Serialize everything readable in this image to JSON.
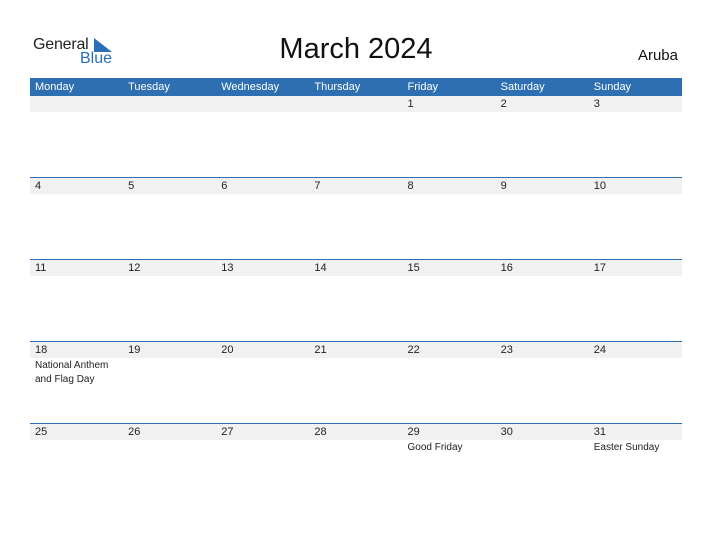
{
  "logo": {
    "part1": "General",
    "part2": "Blue"
  },
  "title": "March 2024",
  "country": "Aruba",
  "weekdays": [
    "Monday",
    "Tuesday",
    "Wednesday",
    "Thursday",
    "Friday",
    "Saturday",
    "Sunday"
  ],
  "weeks": [
    {
      "days": [
        "",
        "",
        "",
        "",
        "1",
        "2",
        "3"
      ],
      "events": [
        "",
        "",
        "",
        "",
        "",
        "",
        ""
      ]
    },
    {
      "days": [
        "4",
        "5",
        "6",
        "7",
        "8",
        "9",
        "10"
      ],
      "events": [
        "",
        "",
        "",
        "",
        "",
        "",
        ""
      ]
    },
    {
      "days": [
        "11",
        "12",
        "13",
        "14",
        "15",
        "16",
        "17"
      ],
      "events": [
        "",
        "",
        "",
        "",
        "",
        "",
        ""
      ]
    },
    {
      "days": [
        "18",
        "19",
        "20",
        "21",
        "22",
        "23",
        "24"
      ],
      "events": [
        "National Anthem and Flag Day",
        "",
        "",
        "",
        "",
        "",
        ""
      ]
    },
    {
      "days": [
        "25",
        "26",
        "27",
        "28",
        "29",
        "30",
        "31"
      ],
      "events": [
        "",
        "",
        "",
        "",
        "Good Friday",
        "",
        "Easter Sunday"
      ]
    }
  ],
  "colors": {
    "accent": "#2e6fb1",
    "strip": "#f1f1f1"
  }
}
